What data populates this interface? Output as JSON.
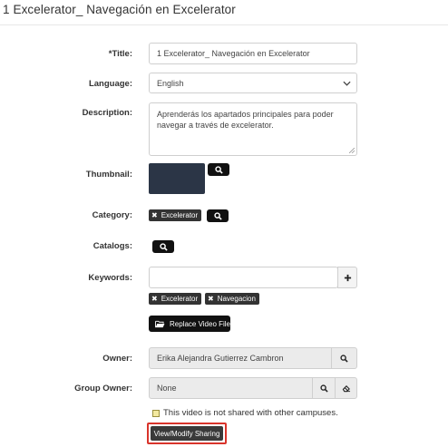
{
  "page": {
    "title": "1 Excelerator_ Navegación en Excelerator"
  },
  "form": {
    "title": {
      "label": "*Title:",
      "value": "1 Excelerator_ Navegación en Excelerator"
    },
    "language": {
      "label": "Language:",
      "value": "English"
    },
    "description": {
      "label": "Description:",
      "value": "Aprenderás los apartados principales para poder navegar a través de excelerator."
    },
    "thumbnail": {
      "label": "Thumbnail:"
    },
    "category": {
      "label": "Category:",
      "tags": [
        "Excelerator"
      ]
    },
    "catalogs": {
      "label": "Catalogs:"
    },
    "keywords": {
      "label": "Keywords:",
      "value": "",
      "tags": [
        "Excelerator",
        "Navegacion"
      ]
    },
    "replace_video": {
      "label": "Replace Video File"
    },
    "owner": {
      "label": "Owner:",
      "value": "Erika Alejandra Gutierrez Cambron"
    },
    "group_owner": {
      "label": "Group Owner:",
      "value": "None"
    },
    "sharing": {
      "note": "This video is not shared with other campuses.",
      "button_label": "View/Modify Sharing",
      "highlight_color": "#d9342b"
    }
  },
  "icons": [
    "search-icon",
    "plus-icon",
    "close-icon",
    "folder-open-icon",
    "eraser-icon",
    "chevron-down-icon",
    "note-icon"
  ]
}
